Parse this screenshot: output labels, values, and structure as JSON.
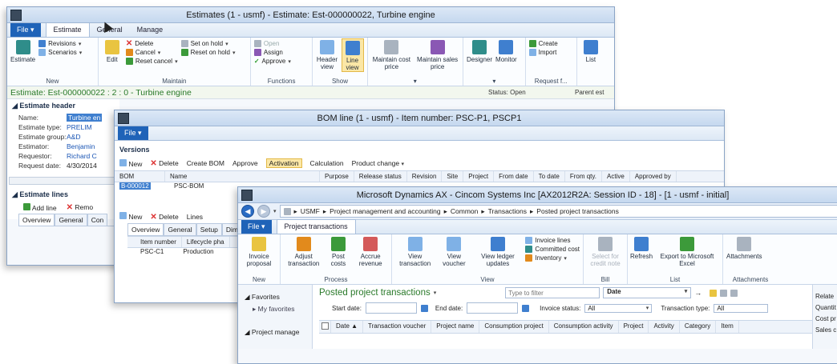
{
  "estimates_window": {
    "title": "Estimates (1 - usmf) - Estimate: Est-000000022, Turbine engine",
    "file_label": "File",
    "tabs": [
      "Estimate",
      "General",
      "Manage"
    ],
    "ribbon": {
      "new_group": {
        "label": "New",
        "estimate": "Estimate",
        "revisions": "Revisions",
        "scenarios": "Scenarios"
      },
      "maintain_group": {
        "label": "Maintain",
        "edit": "Edit",
        "delete": "Delete",
        "cancel": "Cancel",
        "reset_cancel": "Reset cancel",
        "set_on_hold": "Set on hold",
        "reset_on_hold": "Reset on hold"
      },
      "functions_group": {
        "label": "Functions",
        "open": "Open",
        "assign": "Assign",
        "approve": "Approve"
      },
      "show_group": {
        "label": "Show",
        "header_view": "Header view",
        "line_view": "Line view"
      },
      "maintain_cost_price": "Maintain cost price",
      "maintain_sales_price": "Maintain sales price",
      "designer": "Designer",
      "monitor": "Monitor",
      "create": "Create",
      "import": "Import",
      "request_label": "Request f...",
      "list": "List"
    },
    "status_line": "Estimate:  Est-000000022 : 2 : 0 - Turbine engine",
    "status_label": "Status:",
    "status_value": "Open",
    "parent_label": "Parent est",
    "header_fasttab": "Estimate header",
    "fields": [
      {
        "label": "Name:",
        "value": "Turbine en"
      },
      {
        "label": "Estimate type:",
        "value": "PRELIM"
      },
      {
        "label": "Estimate group:",
        "value": "A&D"
      },
      {
        "label": "Estimator:",
        "value": "Benjamin"
      },
      {
        "label": "Requestor:",
        "value": "Richard C"
      },
      {
        "label": "Request date:",
        "value": "4/30/2014"
      }
    ],
    "lines_fasttab": "Estimate lines",
    "add_line": "Add line",
    "remove": "Remo",
    "subtabs": [
      "Overview",
      "General",
      "Con"
    ]
  },
  "bom_window": {
    "title": "BOM line (1 - usmf) - Item number: PSC-P1, PSCP1",
    "file_label": "File",
    "versions_label": "Versions",
    "toolbar": [
      "New",
      "Delete",
      "Create BOM",
      "Approve",
      "Activation",
      "Calculation",
      "Product change"
    ],
    "grid_headers": [
      "BOM",
      "Name",
      "Purpose",
      "Release status",
      "Revision",
      "Site",
      "Project",
      "From date",
      "To date",
      "From qty.",
      "Active",
      "Approved by"
    ],
    "row": {
      "bom": "B-000012",
      "name": "PSC-BOM"
    },
    "lines_toolbar": [
      "New",
      "Delete",
      "Lines"
    ],
    "subtabs": [
      "Overview",
      "General",
      "Setup",
      "Dim"
    ],
    "lines_headers": [
      "Item number",
      "Lifecycle pha"
    ],
    "lines_row": {
      "item": "PSC-C1",
      "lifecycle": "Production"
    }
  },
  "ax_window": {
    "title": "Microsoft Dynamics AX - Cincom Systems Inc [AX2012R2A: Session ID - 18] -  [1 - usmf - initial]",
    "breadcrumb": [
      "USMF",
      "Project management and accounting",
      "Common",
      "Transactions",
      "Posted project transactions"
    ],
    "file_label": "File",
    "tab": "Project transactions",
    "ribbon": {
      "new_group": {
        "label": "New",
        "invoice_proposal": "Invoice proposal"
      },
      "process_group": {
        "label": "Process",
        "adjust": "Adjust transaction",
        "post_costs": "Post costs",
        "accrue": "Accrue revenue"
      },
      "view_group": {
        "label": "View",
        "view_transaction": "View transaction",
        "view_voucher": "View voucher",
        "view_ledger": "View ledger updates",
        "invoice_lines": "Invoice lines",
        "committed_cost": "Committed cost",
        "inventory": "Inventory"
      },
      "bill_group": {
        "label": "Bill",
        "select_credit": "Select for credit note"
      },
      "list_group": {
        "label": "List",
        "refresh": "Refresh",
        "export": "Export to Microsoft Excel"
      },
      "attachments_group": {
        "label": "Attachments",
        "attachments": "Attachments"
      }
    },
    "nav": {
      "favorites": "Favorites",
      "my_favorites": "My favorites",
      "project_manage": "Project manage"
    },
    "list_title": "Posted project transactions",
    "filter_placeholder": "Type to filter",
    "filter_field": "Date",
    "start_date_label": "Start date:",
    "end_date_label": "End date:",
    "invoice_status_label": "Invoice status:",
    "invoice_status_value": "All",
    "transaction_type_label": "Transaction type:",
    "transaction_type_value": "All",
    "columns": [
      "Date",
      "Transaction voucher",
      "Project name",
      "Consumption project",
      "Consumption activity",
      "Project",
      "Activity",
      "Category",
      "Item"
    ],
    "related": [
      "Relate",
      "Quantit",
      "Cost pr",
      "Sales c"
    ]
  }
}
